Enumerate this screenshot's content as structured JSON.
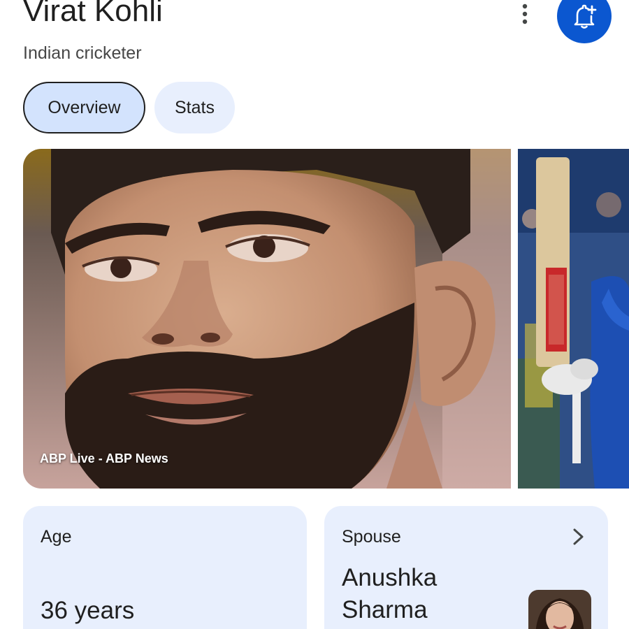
{
  "header": {
    "title": "Virat Kohli",
    "subtitle": "Indian cricketer",
    "menu_icon": "more-vert-icon",
    "follow_icon": "bell-plus-icon"
  },
  "tabs": [
    {
      "label": "Overview",
      "selected": true
    },
    {
      "label": "Stats",
      "selected": false
    }
  ],
  "images": {
    "main_caption": "ABP Live - ABP News"
  },
  "cards": {
    "age": {
      "label": "Age",
      "value": "36 years"
    },
    "spouse": {
      "label": "Spouse",
      "value": "Anushka Sharma",
      "chevron_icon": "chevron-right-icon"
    }
  },
  "colors": {
    "accent": "#0b57d0",
    "chip_selected": "#d3e3fd",
    "card_bg": "#e8effd"
  }
}
